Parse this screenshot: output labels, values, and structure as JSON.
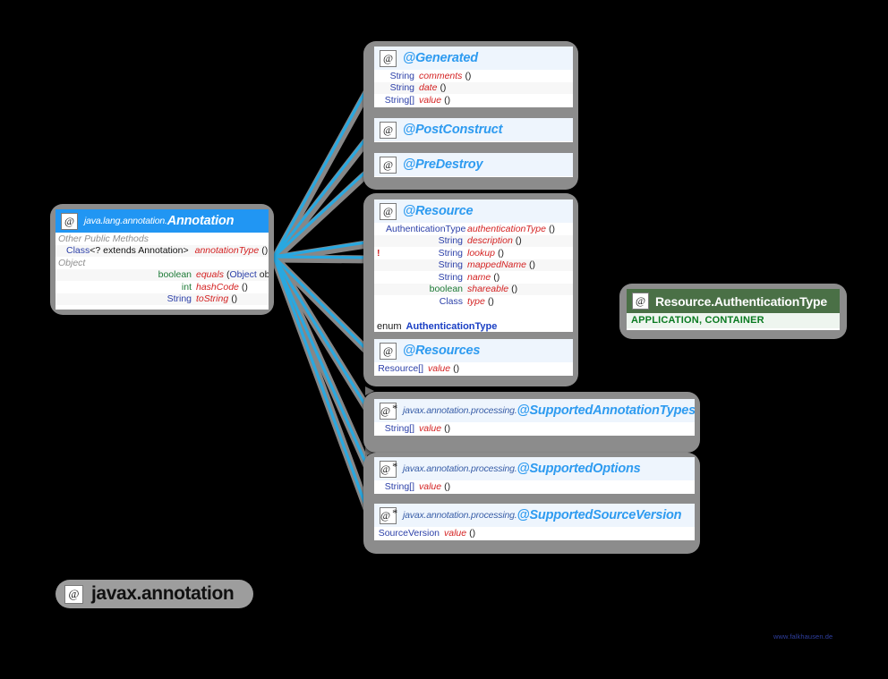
{
  "diagram": {
    "package_label": "javax.annotation",
    "package_icon": "at-icon",
    "watermark": "www.falkhausen.de"
  },
  "main_class": {
    "icon": "at-icon",
    "package": "java.lang.annotation.",
    "name": "Annotation",
    "groups": [
      {
        "label": "Other Public Methods"
      },
      {
        "label": "Object"
      }
    ],
    "members": [
      {
        "group": "Other Public Methods"
      },
      {
        "type_prefix": "Class",
        "type_generic": "<? extends Annotation>",
        "name": "annotationType",
        "args": "()"
      },
      {
        "group": "Object"
      },
      {
        "type": "boolean",
        "type_color": "green",
        "name": "equals",
        "args": "(Object obj)"
      },
      {
        "type": "int",
        "type_color": "green",
        "name": "hashCode",
        "args": "()"
      },
      {
        "type": "String",
        "type_color": "blue",
        "name": "toString",
        "args": "()"
      }
    ]
  },
  "annotations": [
    {
      "icon": "at-icon",
      "package": "",
      "name": "@Generated",
      "members": [
        {
          "type": "String",
          "name": "comments",
          "args": "()"
        },
        {
          "type": "String",
          "name": "date",
          "args": "()"
        },
        {
          "type": "String[]",
          "name": "value",
          "args": "()"
        }
      ]
    },
    {
      "icon": "at-icon",
      "package": "",
      "name": "@PostConstruct",
      "members": []
    },
    {
      "icon": "at-icon",
      "package": "",
      "name": "@PreDestroy",
      "members": []
    },
    {
      "icon": "at-icon",
      "package": "",
      "name": "@Resource",
      "members": [
        {
          "type": "AuthenticationType",
          "name": "authenticationType",
          "args": "()"
        },
        {
          "type": "String",
          "name": "description",
          "args": "()"
        },
        {
          "type": "String",
          "name": "lookup",
          "args": "()",
          "deprecated_marker": "!"
        },
        {
          "type": "String",
          "name": "mappedName",
          "args": "()"
        },
        {
          "type": "String",
          "name": "name",
          "args": "()"
        },
        {
          "type": "boolean",
          "type_color": "green",
          "name": "shareable",
          "args": "()"
        },
        {
          "type": "Class",
          "name": "type",
          "args": "()"
        }
      ],
      "nested": {
        "keyword": "enum",
        "name": "AuthenticationType"
      }
    },
    {
      "icon": "at-icon",
      "package": "",
      "name": "@Resources",
      "members": [
        {
          "type": "Resource[]",
          "name": "value",
          "args": "()"
        }
      ]
    },
    {
      "icon": "at-star-icon",
      "package": "javax.annotation.processing.",
      "name": "@SupportedAnnotationTypes",
      "members": [
        {
          "type": "String[]",
          "name": "value",
          "args": "()"
        }
      ]
    },
    {
      "icon": "at-star-icon",
      "package": "javax.annotation.processing.",
      "name": "@SupportedOptions",
      "members": [
        {
          "type": "String[]",
          "name": "value",
          "args": "()"
        }
      ]
    },
    {
      "icon": "at-star-icon",
      "package": "javax.annotation.processing.",
      "name": "@SupportedSourceVersion",
      "members": [
        {
          "type": "SourceVersion",
          "name": "value",
          "args": "()"
        }
      ]
    }
  ],
  "enum_box": {
    "icon": "at-icon",
    "name": "Resource.AuthenticationType",
    "values": "APPLICATION, CONTAINER"
  },
  "colors": {
    "header_blue": "#2196f3",
    "annotation_name": "#2e9bf0",
    "member_name": "#d42222",
    "type_blue": "#2b3fa8",
    "type_green": "#1d7a36",
    "enum_header": "#4a7046",
    "enum_value": "#0a7a21",
    "connector": "#29a8e0",
    "container_gray": "#8c8c8c",
    "background": "#000000"
  }
}
